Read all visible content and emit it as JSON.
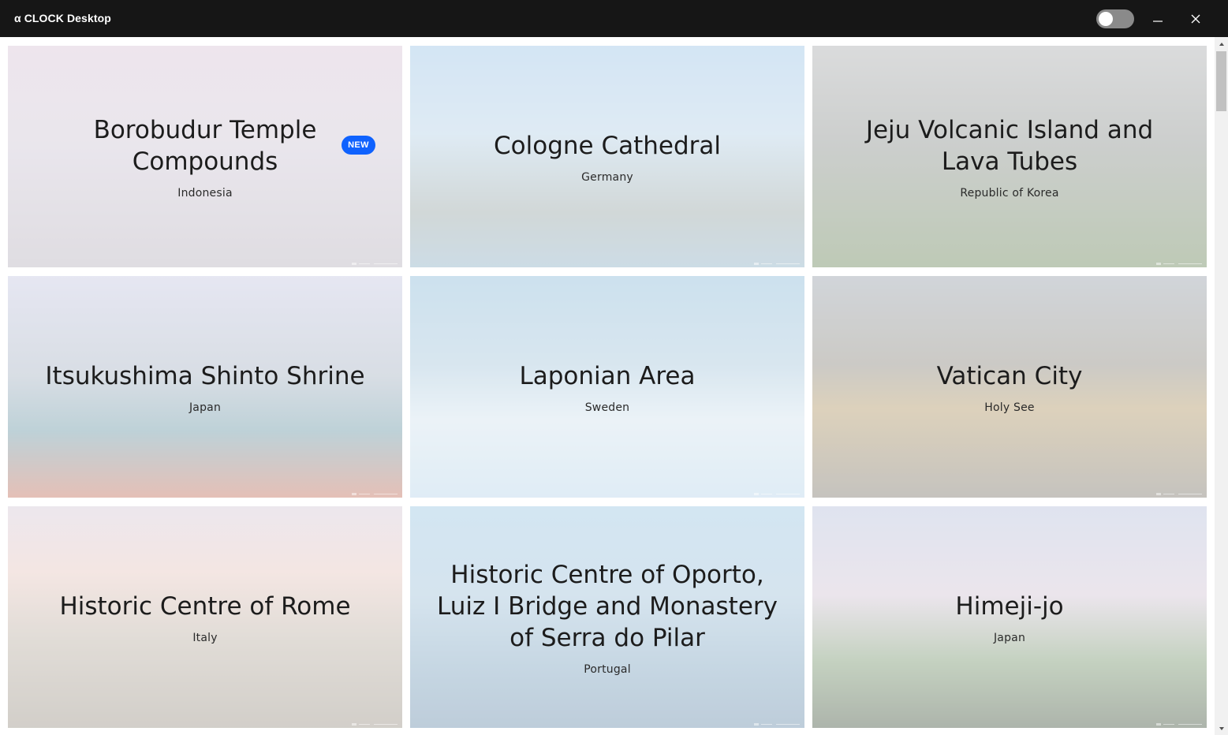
{
  "app": {
    "title": "α CLOCK Desktop",
    "dark_mode_toggle": "off"
  },
  "window_controls": {
    "minimize_icon": "minimize-icon",
    "close_icon": "close-icon"
  },
  "badge": {
    "new_label": "NEW"
  },
  "colors": {
    "titlebar": "#161616",
    "badge": "#0f62fe",
    "toggle_off": "#8a8a8a"
  },
  "cards": [
    {
      "title": "Borobudur Temple Compounds",
      "country": "Indonesia",
      "is_new": true,
      "bg": "linear-gradient(180deg,#d9c6d8 0%,#cfc7d6 45%,#b8b3be 100%)"
    },
    {
      "title": "Cologne Cathedral",
      "country": "Germany",
      "is_new": false,
      "bg": "linear-gradient(180deg,#9fc6e6 0%,#b7d2e6 40%,#9aa8a8 75%,#8fb1c6 100%)"
    },
    {
      "title": "Jeju Volcanic Island and Lava Tubes",
      "country": "Republic of Korea",
      "is_new": false,
      "bg": "linear-gradient(180deg,#aeb0b2 0%,#8e9390 45%,#6f8a5e 100%)"
    },
    {
      "title": "Itsukushima Shinto Shrine",
      "country": "Japan",
      "is_new": false,
      "bg": "linear-gradient(180deg,#c7c9e2 0%,#a9b5c4 45%,#6f9aa8 70%,#c4735f 100%)"
    },
    {
      "title": "Laponian Area",
      "country": "Sweden",
      "is_new": false,
      "bg": "linear-gradient(180deg,#8fbcd9 0%,#a9c8dc 40%,#d3e3ee 65%,#b9d6ea 100%)"
    },
    {
      "title": "Vatican City",
      "country": "Holy See",
      "is_new": false,
      "bg": "linear-gradient(180deg,#9aa2ac 0%,#8d8a80 40%,#b39a6a 60%,#7f7a70 100%)"
    },
    {
      "title": "Historic Centre of Rome",
      "country": "Italy",
      "is_new": false,
      "bg": "linear-gradient(180deg,#d6c9d8 0%,#e6c8c0 30%,#bcb2a6 60%,#9c9488 100%)"
    },
    {
      "title": "Historic Centre of Oporto, Luiz I Bridge and Monastery of Serra do Pilar",
      "country": "Portugal",
      "is_new": false,
      "bg": "linear-gradient(180deg,#9dc7e3 0%,#a3c3da 40%,#7fa4bf 75%,#6e90ad 100%)"
    },
    {
      "title": "Himeji-jo",
      "country": "Japan",
      "is_new": false,
      "bg": "linear-gradient(180deg,#b8c2dc 0%,#d3c6d6 40%,#7d9a74 70%,#4a5a46 100%)"
    }
  ]
}
